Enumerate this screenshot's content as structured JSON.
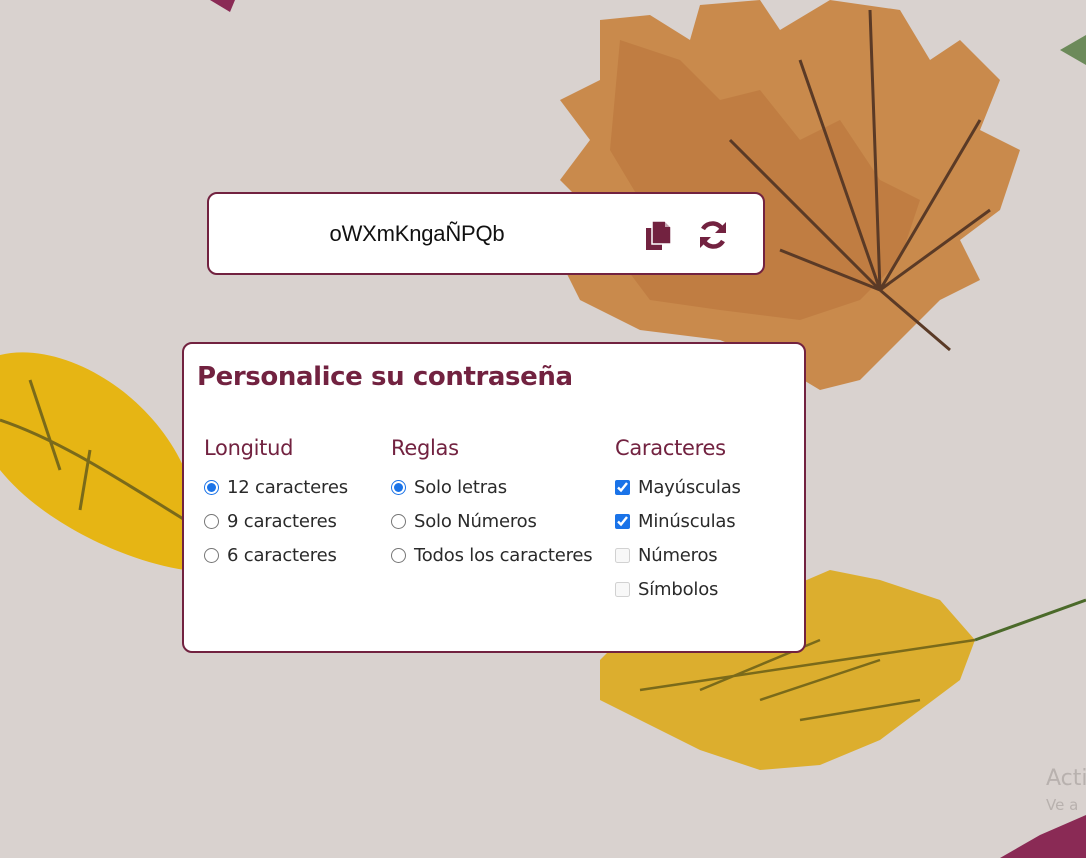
{
  "password": {
    "value": "oWXmKngaÑPQb",
    "copy_icon": "copy-icon",
    "refresh_icon": "refresh-icon"
  },
  "customize": {
    "title": "Personalice su contraseña",
    "length": {
      "heading": "Longitud",
      "options": [
        {
          "label": "12 caracteres",
          "checked": true
        },
        {
          "label": "9 caracteres",
          "checked": false
        },
        {
          "label": "6 caracteres",
          "checked": false
        }
      ]
    },
    "rules": {
      "heading": "Reglas",
      "options": [
        {
          "label": "Solo letras",
          "checked": true
        },
        {
          "label": "Solo Números",
          "checked": false
        },
        {
          "label": "Todos los caracteres",
          "checked": false
        }
      ]
    },
    "characters": {
      "heading": "Caracteres",
      "options": [
        {
          "label": "Mayúsculas",
          "checked": true,
          "disabled": false
        },
        {
          "label": "Minúsculas",
          "checked": true,
          "disabled": false
        },
        {
          "label": "Números",
          "checked": false,
          "disabled": true
        },
        {
          "label": "Símbolos",
          "checked": false,
          "disabled": true
        }
      ]
    }
  },
  "watermark": {
    "line1": "Acti",
    "line2": "Ve a"
  },
  "colors": {
    "accent": "#722240",
    "background": "#d9d2cf",
    "control": "#1a73e8"
  }
}
